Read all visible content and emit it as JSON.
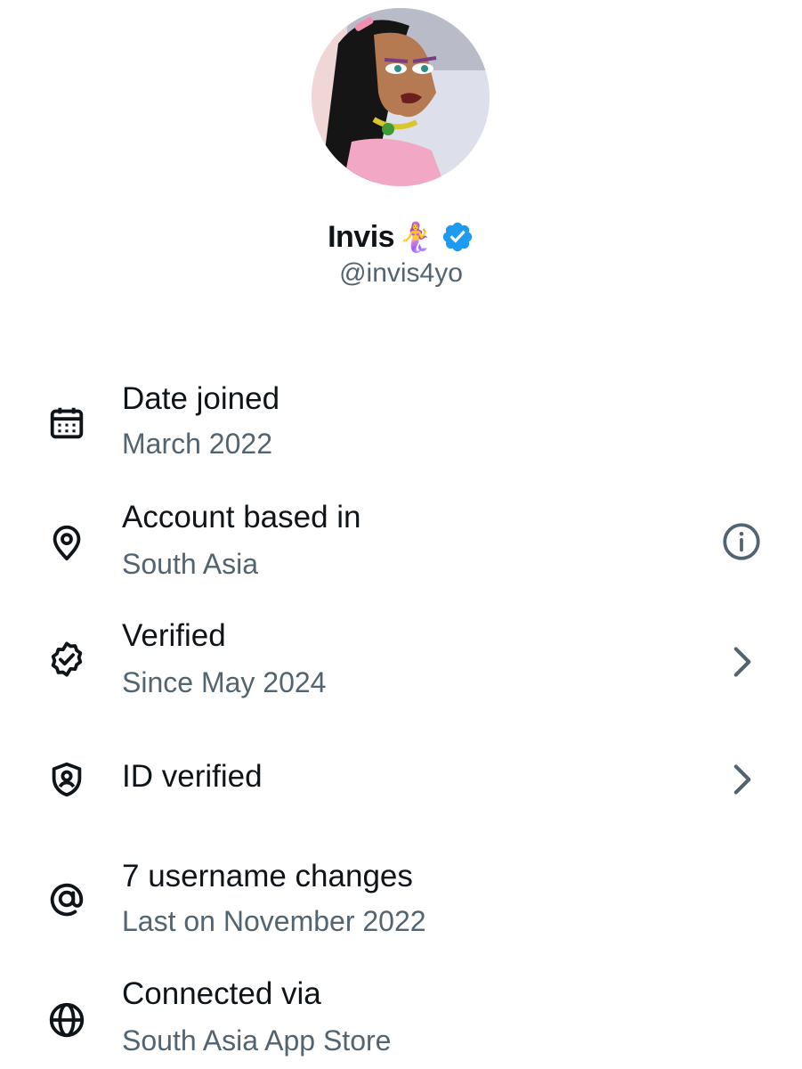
{
  "profile": {
    "display_name": "Invis",
    "emoji": "🧜‍♀️",
    "handle": "@invis4yo",
    "avatar_icon": "cartoon-avatar",
    "verified_icon": "verified-badge-icon",
    "verified_color": "#1d9bf0"
  },
  "details": [
    {
      "title": "Date joined",
      "subtitle": "March 2022",
      "icon": "calendar-icon"
    },
    {
      "title": "Account based in",
      "subtitle": "South Asia",
      "icon": "location-pin-icon",
      "trailing": "info-icon"
    },
    {
      "title": "Verified",
      "subtitle": "Since May 2024",
      "icon": "verified-seal-icon",
      "trailing": "chevron-right-icon"
    },
    {
      "title": "ID verified",
      "icon": "id-shield-icon",
      "trailing": "chevron-right-icon"
    },
    {
      "title": "7 username changes",
      "subtitle": "Last on November 2022",
      "icon": "at-sign-icon"
    },
    {
      "title": "Connected via",
      "subtitle": "South Asia App Store",
      "icon": "globe-icon"
    }
  ],
  "colors": {
    "primary_text": "#0f1419",
    "secondary_text": "#536471"
  }
}
